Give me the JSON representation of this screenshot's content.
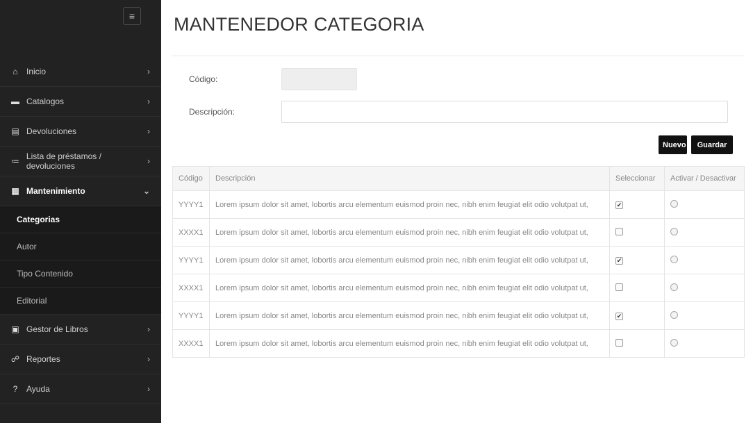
{
  "sidebar": {
    "toggle_icon": "≡",
    "items": [
      {
        "label": "Inicio",
        "icon": "home-icon",
        "glyph": "⌂"
      },
      {
        "label": "Catalogos",
        "icon": "folder-icon",
        "glyph": "▬"
      },
      {
        "label": "Devoluciones",
        "icon": "document-icon",
        "glyph": "▤"
      },
      {
        "label": "Lista de préstamos / devoluciones",
        "icon": "list-icon",
        "glyph": "≔"
      },
      {
        "label": "Mantenimiento",
        "icon": "grid-icon",
        "glyph": "▦"
      },
      {
        "label": "Gestor de Libros",
        "icon": "book-icon",
        "glyph": "▣"
      },
      {
        "label": "Reportes",
        "icon": "report-icon",
        "glyph": "☍"
      },
      {
        "label": "Ayuda",
        "icon": "question-icon",
        "glyph": "?"
      }
    ],
    "chevron_right": "›",
    "chevron_down": "⌄",
    "subitems": [
      "Categorias",
      "Autor",
      "Tipo Contenido",
      "Editorial"
    ]
  },
  "page": {
    "title": "MANTENEDOR CATEGORIA"
  },
  "form": {
    "codigo_label": "Código:",
    "codigo_value": "",
    "descripcion_label": "Descripción:",
    "descripcion_value": ""
  },
  "buttons": {
    "nuevo": "Nuevo",
    "guardar": "Guardar"
  },
  "table": {
    "headers": [
      "Código",
      "Descripción",
      "Seleccionar",
      "Activar / Desactivar"
    ],
    "rows": [
      {
        "codigo": "YYYY1",
        "descripcion": "Lorem ipsum dolor sit amet, lobortis arcu elementum euismod proin nec, nibh enim feugiat elit odio volutpat ut,",
        "seleccionado": true
      },
      {
        "codigo": "XXXX1",
        "descripcion": "Lorem ipsum dolor sit amet, lobortis arcu elementum euismod proin nec, nibh enim feugiat elit odio volutpat ut,",
        "seleccionado": false
      },
      {
        "codigo": "YYYY1",
        "descripcion": "Lorem ipsum dolor sit amet, lobortis arcu elementum euismod proin nec, nibh enim feugiat elit odio volutpat ut,",
        "seleccionado": true
      },
      {
        "codigo": "XXXX1",
        "descripcion": "Lorem ipsum dolor sit amet, lobortis arcu elementum euismod proin nec, nibh enim feugiat elit odio volutpat ut,",
        "seleccionado": false
      },
      {
        "codigo": "YYYY1",
        "descripcion": "Lorem ipsum dolor sit amet, lobortis arcu elementum euismod proin nec, nibh enim feugiat elit odio volutpat ut,",
        "seleccionado": true
      },
      {
        "codigo": "XXXX1",
        "descripcion": "Lorem ipsum dolor sit amet, lobortis arcu elementum euismod proin nec, nibh enim feugiat elit odio volutpat ut,",
        "seleccionado": false
      }
    ]
  },
  "colors": {
    "sidebar_bg": "#222222",
    "button_bg": "#111111"
  }
}
